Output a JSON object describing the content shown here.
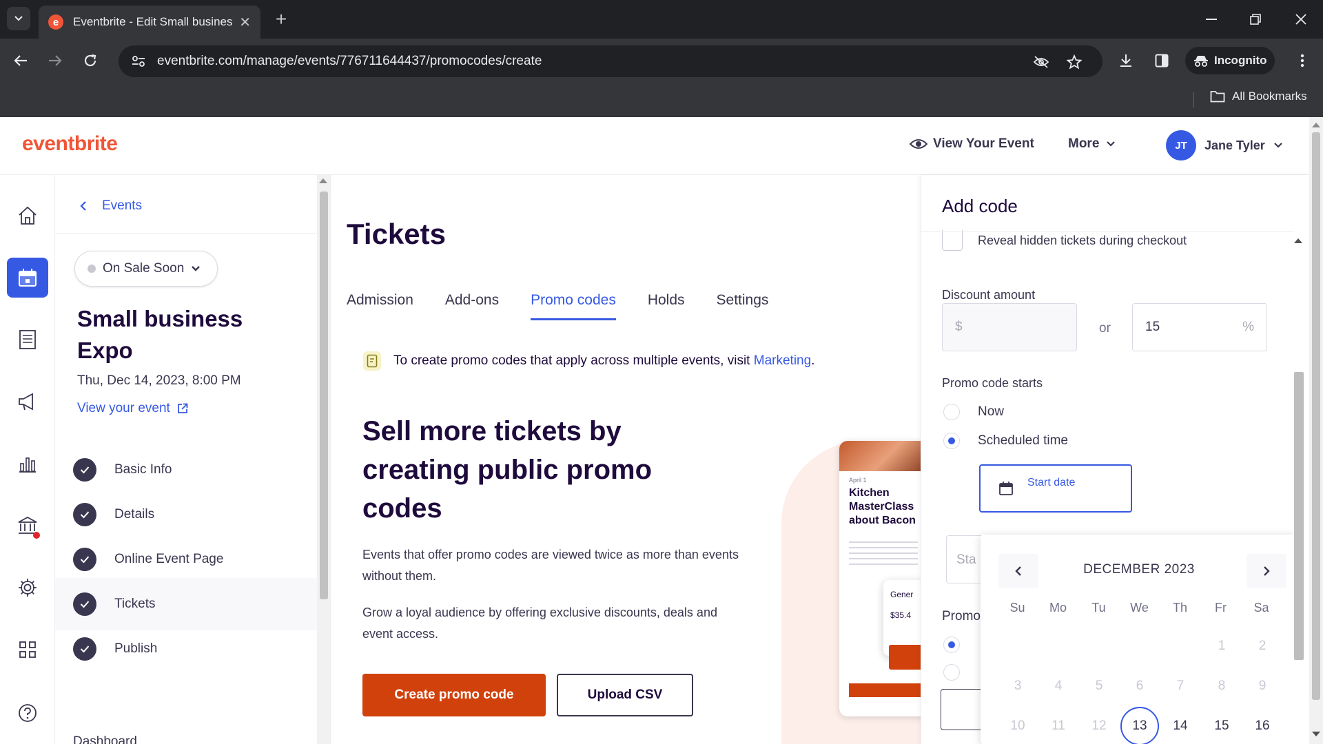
{
  "browser": {
    "tab_title": "Eventbrite - Edit Small business",
    "url": "eventbrite.com/manage/events/776711644437/promocodes/create",
    "incognito_label": "Incognito",
    "bookmarks_label": "All Bookmarks"
  },
  "header": {
    "logo": "eventbrite",
    "view_event": "View Your Event",
    "more": "More",
    "user_initials": "JT",
    "user_name": "Jane Tyler"
  },
  "sidebar": {
    "back_label": "Events",
    "status": "On Sale Soon",
    "event_name": "Small business Expo",
    "event_date": "Thu, Dec 14, 2023, 8:00 PM",
    "view_link": "View your event",
    "steps": [
      {
        "label": "Basic Info"
      },
      {
        "label": "Details"
      },
      {
        "label": "Online Event Page"
      },
      {
        "label": "Tickets"
      },
      {
        "label": "Publish"
      }
    ],
    "next_section": "Dashboard"
  },
  "main": {
    "title": "Tickets",
    "tabs": [
      {
        "label": "Admission"
      },
      {
        "label": "Add-ons"
      },
      {
        "label": "Promo codes"
      },
      {
        "label": "Holds"
      },
      {
        "label": "Settings"
      }
    ],
    "info_text": "To create promo codes that apply across multiple events, visit",
    "info_link": "Marketing",
    "info_end": ".",
    "hero_title": "Sell more tickets by creating public promo codes",
    "hero_p1": "Events that offer promo codes are viewed twice as more than events without them.",
    "hero_p2": "Grow a loyal audience by offering exclusive discounts, deals and event access.",
    "create_button": "Create promo code",
    "upload_button": "Upload CSV",
    "illustration": {
      "date": "April 1",
      "title": "Kitchen MasterClass about Bacon",
      "card_label": "Gener",
      "card_price": "$35.4"
    }
  },
  "panel": {
    "title": "Add code",
    "reveal_label": "Reveal hidden tickets during checkout",
    "discount_label": "Discount amount",
    "currency_symbol": "$",
    "or_label": "or",
    "percent_value": "15",
    "percent_symbol": "%",
    "starts_label": "Promo code starts",
    "option_now": "Now",
    "option_scheduled": "Scheduled time",
    "start_date_label": "Start date",
    "hidden_input_text": "Sta",
    "hidden_label_text": "Promo"
  },
  "datepicker": {
    "month": "DECEMBER 2023",
    "weekdays": [
      "Su",
      "Mo",
      "Tu",
      "We",
      "Th",
      "Fr",
      "Sa"
    ],
    "week1": [
      "1",
      "2"
    ],
    "week2": [
      "3",
      "4",
      "5",
      "6",
      "7",
      "8",
      "9"
    ],
    "week3": [
      "10",
      "11",
      "12",
      "13",
      "14",
      "15",
      "16"
    ],
    "selected_day": "13"
  },
  "colors": {
    "brand_orange": "#f05537",
    "accent_blue": "#3659e3",
    "cta_orange": "#d1410c"
  }
}
